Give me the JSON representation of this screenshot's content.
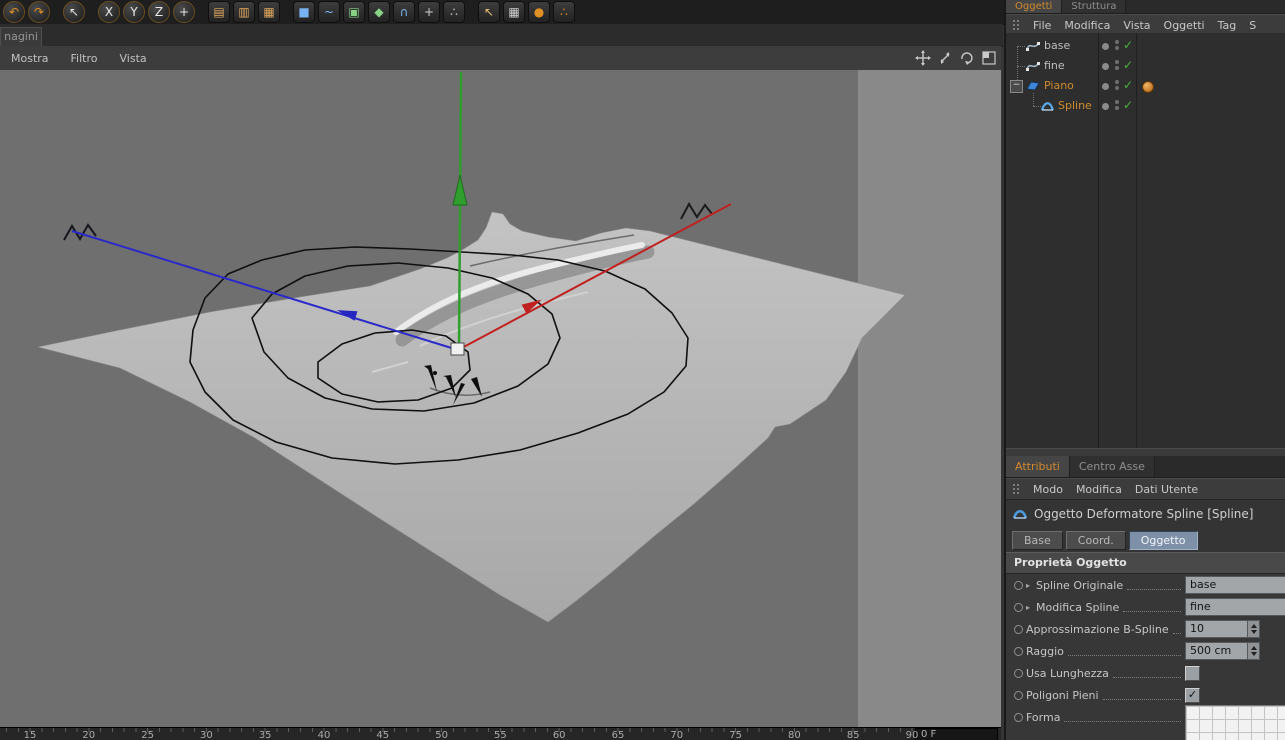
{
  "colors": {
    "accent_orange": "#d08a2e",
    "selection_blue": "#7e90a8",
    "check_green": "#46b33c",
    "axis_x_red": "#c02020",
    "axis_y_green": "#2f9e2f",
    "axis_z_blue": "#2a2ac8",
    "viewport_gray": "#6f6f6f"
  },
  "toolbar": {
    "icons": [
      {
        "name": "undo-icon",
        "glyph": "↶",
        "shape": "circle",
        "color": "#e09025"
      },
      {
        "name": "redo-icon",
        "glyph": "↷",
        "shape": "circle",
        "color": "#e09025"
      },
      {
        "separator": true
      },
      {
        "name": "live-selection-icon",
        "glyph": "↖",
        "shape": "circle",
        "color": "#e2e2e2"
      },
      {
        "separator": true
      },
      {
        "name": "x-axis-lock-icon",
        "glyph": "X",
        "shape": "circle",
        "color": "#e8e8e8"
      },
      {
        "name": "y-axis-lock-icon",
        "glyph": "Y",
        "shape": "circle",
        "color": "#e8e8e8"
      },
      {
        "name": "z-axis-lock-icon",
        "glyph": "Z",
        "shape": "circle",
        "color": "#e8e8e8"
      },
      {
        "name": "coordinate-system-icon",
        "glyph": "+",
        "shape": "circle",
        "color": "#e8e8e8"
      },
      {
        "separator": true
      },
      {
        "name": "render-view-icon",
        "glyph": "▤",
        "shape": "square",
        "color": "#e3a95f"
      },
      {
        "name": "render-region-icon",
        "glyph": "▥",
        "shape": "square",
        "color": "#e3a95f"
      },
      {
        "name": "render-settings-icon",
        "glyph": "▦",
        "shape": "square",
        "color": "#e3a95f"
      },
      {
        "separator": true
      },
      {
        "name": "primitive-cube-icon",
        "glyph": "■",
        "shape": "square",
        "color": "#79b4f2"
      },
      {
        "name": "spline-pen-icon",
        "glyph": "~",
        "shape": "square",
        "color": "#79b4f2"
      },
      {
        "name": "array-object-icon",
        "glyph": "▣",
        "shape": "square",
        "color": "#86d386"
      },
      {
        "name": "deformer-icon",
        "glyph": "◆",
        "shape": "square",
        "color": "#86d386"
      },
      {
        "name": "nurbs-icon",
        "glyph": "∩",
        "shape": "square",
        "color": "#79b4f2"
      },
      {
        "name": "scene-tools-icon",
        "glyph": "+",
        "shape": "square",
        "color": "#cfcfcf"
      },
      {
        "name": "particles-icon",
        "glyph": "∴",
        "shape": "square",
        "color": "#cfcfcf"
      },
      {
        "separator": true
      },
      {
        "name": "move-tool-icon",
        "glyph": "↖",
        "shape": "square",
        "color": "#e6c278"
      },
      {
        "name": "structure-table-icon",
        "glyph": "▦",
        "shape": "square",
        "color": "#cfcfcf"
      },
      {
        "name": "globe-icon",
        "glyph": "●",
        "shape": "square",
        "color": "#e09025"
      },
      {
        "name": "kernel-dots-icon",
        "glyph": "∴",
        "shape": "square",
        "color": "#e09025"
      }
    ]
  },
  "left_dock": {
    "tab_label": "nagini"
  },
  "viewport": {
    "menu": [
      "Mostra",
      "Filtro",
      "Vista"
    ],
    "nav_icons": [
      "pan-view-icon",
      "zoom-view-icon",
      "rotate-view-icon",
      "toggle-view-icon"
    ]
  },
  "timeline": {
    "ticks": [
      15,
      20,
      25,
      30,
      35,
      40,
      45,
      50,
      55,
      60,
      65,
      70,
      75,
      80,
      85,
      90
    ],
    "frame_field": "0 F"
  },
  "object_manager": {
    "tabs": [
      "Oggetti",
      "Struttura"
    ],
    "active_tab": "Oggetti",
    "menu": [
      "File",
      "Modifica",
      "Vista",
      "Oggetti",
      "Tag",
      "S"
    ],
    "tree": [
      {
        "label": "base",
        "icon": "spline-object-icon",
        "depth": 0,
        "selected": false,
        "enabled": true
      },
      {
        "label": "fine",
        "icon": "spline-object-icon",
        "depth": 0,
        "selected": false,
        "enabled": true
      },
      {
        "label": "Piano",
        "icon": "plane-object-icon",
        "depth": 0,
        "selected": true,
        "enabled": true,
        "expanded": true,
        "tag": "phong-tag"
      },
      {
        "label": "Spline",
        "icon": "spline-deformer-icon",
        "depth": 1,
        "selected": true,
        "enabled": true
      }
    ]
  },
  "attribute_manager": {
    "tabs": [
      "Attributi",
      "Centro Asse"
    ],
    "active_tab": "Attributi",
    "menu": [
      "Modo",
      "Modifica",
      "Dati Utente"
    ],
    "title": "Oggetto Deformatore Spline [Spline]",
    "section_tabs": [
      "Base",
      "Coord.",
      "Oggetto"
    ],
    "active_section_tab": "Oggetto",
    "group_header": "Proprietà Oggetto",
    "properties": [
      {
        "label": "Spline Originale",
        "type": "link",
        "value": "base"
      },
      {
        "label": "Modifica Spline",
        "type": "link",
        "value": "fine"
      },
      {
        "label": "Approssimazione B-Spline",
        "type": "number",
        "value": "10"
      },
      {
        "label": "Raggio",
        "type": "number",
        "value": "500 cm"
      },
      {
        "label": "Usa Lunghezza",
        "type": "checkbox",
        "mark": ""
      },
      {
        "label": "Poligoni Pieni",
        "type": "checkbox",
        "mark": "✓"
      },
      {
        "label": "Forma",
        "type": "group"
      }
    ]
  }
}
